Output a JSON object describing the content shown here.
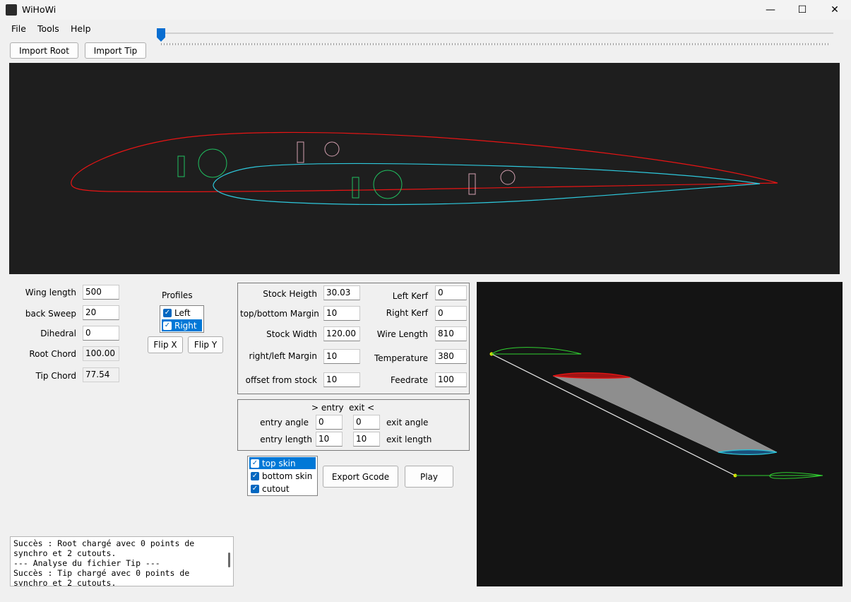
{
  "window": {
    "title": "WiHoWi",
    "minimize": "—",
    "maximize": "☐",
    "close": "✕"
  },
  "menu": {
    "file": "File",
    "tools": "Tools",
    "help": "Help"
  },
  "toolbar": {
    "import_root": "Import Root",
    "import_tip": "Import Tip"
  },
  "slider": {
    "value": 0
  },
  "params": {
    "wing_length": {
      "label": "Wing length",
      "value": "500"
    },
    "back_sweep": {
      "label": "back Sweep",
      "value": "20"
    },
    "dihedral": {
      "label": "Dihedral",
      "value": "0"
    },
    "root_chord": {
      "label": "Root Chord",
      "value": "100.00"
    },
    "tip_chord": {
      "label": "Tip Chord",
      "value": "77.54"
    }
  },
  "profiles": {
    "title": "Profiles",
    "items": [
      {
        "label": "Left",
        "checked": true,
        "selected": false
      },
      {
        "label": "Right",
        "checked": true,
        "selected": true
      }
    ],
    "flip_x": "Flip X",
    "flip_y": "Flip Y"
  },
  "stock": {
    "height": {
      "label": "Stock Heigth",
      "value": "30.03"
    },
    "tb_margin": {
      "label": "top/bottom Margin",
      "value": "10"
    },
    "width": {
      "label": "Stock Width",
      "value": "120.00"
    },
    "rl_margin": {
      "label": "right/left Margin",
      "value": "10"
    },
    "offset": {
      "label": "offset from stock",
      "value": "10"
    },
    "left_kerf": {
      "label": "Left Kerf",
      "value": "0"
    },
    "right_kerf": {
      "label": "Right Kerf",
      "value": "0"
    },
    "wire_length": {
      "label": "Wire Length",
      "value": "810"
    },
    "temperature": {
      "label": "Temperature",
      "value": "380"
    },
    "feedrate": {
      "label": "Feedrate",
      "value": "100"
    }
  },
  "entry_exit": {
    "entry_heading": "> entry",
    "exit_heading": "exit <",
    "entry_angle": {
      "label": "entry angle",
      "value": "0"
    },
    "exit_angle": {
      "label": "exit angle",
      "value": "0"
    },
    "entry_length": {
      "label": "entry length",
      "value": "10"
    },
    "exit_length": {
      "label": "exit length",
      "value": "10"
    }
  },
  "cut_options": [
    {
      "label": "top skin",
      "checked": true,
      "selected": true
    },
    {
      "label": "bottom skin",
      "checked": true,
      "selected": false
    },
    {
      "label": "cutout",
      "checked": true,
      "selected": false
    }
  ],
  "actions": {
    "export": "Export Gcode",
    "play": "Play"
  },
  "log": [
    "Succès : Root chargé avec 0 points de",
    "synchro et 2 cutouts.",
    "--- Analyse du fichier Tip ---",
    "Succès : Tip chargé avec 0 points de",
    "synchro et 2 cutouts."
  ],
  "colors": {
    "root_profile": "#e81414",
    "tip_profile": "#2ec8dc",
    "spar_cutout": "#20c060",
    "secondary_cutout": "#d4a0b0",
    "canvas_bg": "#1e1e1e",
    "view3d_bg": "#141414",
    "accent": "#0078d7"
  }
}
